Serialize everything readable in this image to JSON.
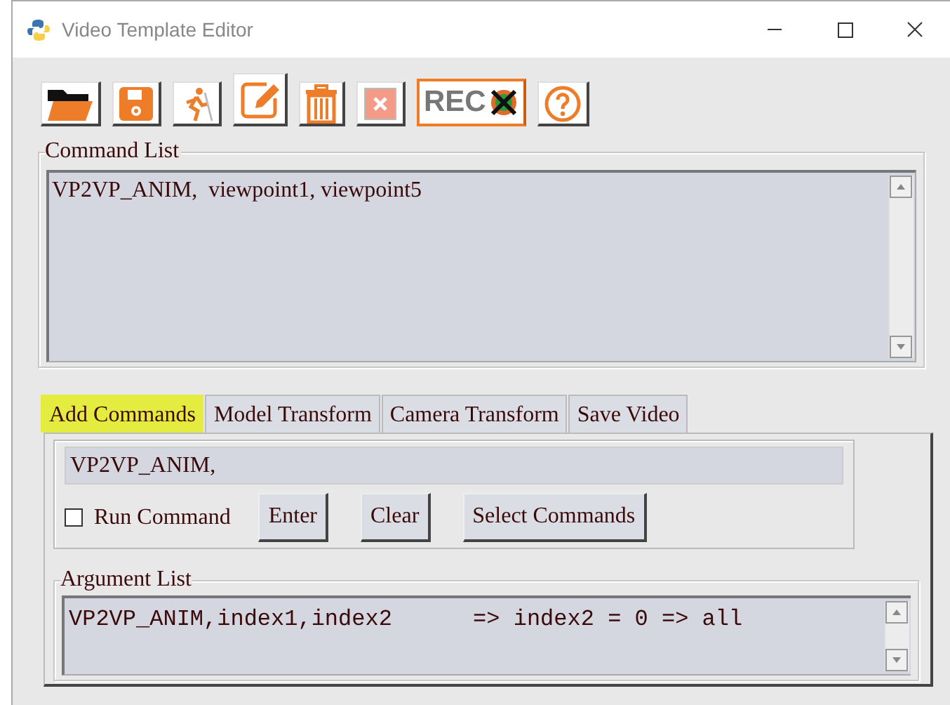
{
  "window": {
    "title": "Video Template Editor"
  },
  "toolbar": [
    {
      "kind": "open"
    },
    {
      "kind": "save"
    },
    {
      "kind": "run"
    },
    {
      "kind": "edit"
    },
    {
      "kind": "trash"
    },
    {
      "kind": "delete"
    },
    {
      "kind": "record",
      "label": "REC"
    },
    {
      "kind": "help"
    }
  ],
  "command_list": {
    "title": "Command List",
    "lines": [
      "VP2VP_ANIM,  viewpoint1, viewpoint5"
    ]
  },
  "tabs": [
    {
      "label": "Add Commands",
      "selected": true
    },
    {
      "label": "Model Transform",
      "selected": false
    },
    {
      "label": "Camera Transform",
      "selected": false
    },
    {
      "label": "Save Video",
      "selected": false
    }
  ],
  "command_field": {
    "value": "VP2VP_ANIM,"
  },
  "run_command": {
    "label": "Run Command",
    "checked": false
  },
  "buttons": [
    "Enter",
    "Clear",
    "Select Commands"
  ],
  "argument_list": {
    "title": "Argument List",
    "lines": [
      "VP2VP_ANIM,index1,index2      => index2 = 0 => all"
    ]
  }
}
